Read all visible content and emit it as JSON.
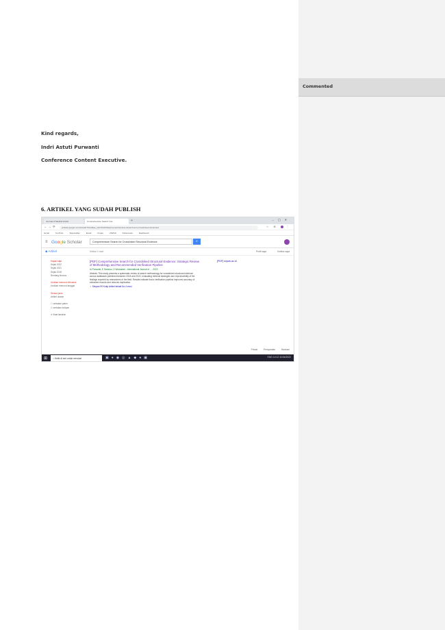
{
  "letter": {
    "closing": "Kind regards,",
    "name": "Indri Astuti Purwanti",
    "role": "Conference Content Executive."
  },
  "section_heading": "6.   ARTIKEL YANG SUDAH PUBLISH",
  "comments": {
    "header": "Commented"
  },
  "screenshot": {
    "tabs": [
      "Journal of Medical Article",
      "Comprehensive Search Cas"
    ],
    "url": "scholar.google.com/scholar?hl=id&as_sdt=0%2C5&q=Comprehensive+Search+for+Crosslinked+Structural",
    "bookmarks": [
      "Gmail",
      "YouTube",
      "Terjemahan",
      "Email",
      "Unpas",
      "UNPAS",
      "Kubernetes",
      "Dashboard"
    ],
    "logo": {
      "g1": "Go",
      "g2": "o",
      "g3": "g",
      "g4": "le",
      "scholar": "Scholar"
    },
    "search_query": "Comprehensive Search for Crosslinked Structural Evidence",
    "articles_label": "Artikel",
    "result_count": "Sekitar 1 hasil",
    "my_profile": "Profil saya",
    "my_library": "Koleksi saya",
    "sidebar": [
      "Kapan saja",
      "Sejak 2022",
      "Sejak 2021",
      "Sejak 2018",
      "Rentang khusus...",
      "",
      "Urutkan menurut relevansi",
      "Urutkan menurut tanggal",
      "",
      "Semua jenis",
      "Artikel ulasan",
      "",
      "sertakan paten",
      "sertakan kutipan",
      "",
      "Buat lansiran"
    ],
    "result": {
      "title": "[PDF] Comprehensive Search for Crosslinked Structural Evidence: Strategic Review of Methodology and Recommended Verification Pipeline",
      "authors": "IA Purwanti, E Santoso, D Wulandari - International Journal of ..., 2022",
      "snippet": "Abstrak: This study presents a systematic review of search methodology for crosslinked structural evidence across databases published between 2018 and 2022, evaluating retrieval strategies and reproducibility of the findings reported by researchers in the field. Results indicate that a verification pipeline improves accuracy of extracted records and reduces duplication.",
      "links": "☆ Simpan   99 Kutip   Artikel terkait   Ke-4 versi"
    },
    "pdf_link": "[PDF] unpas.ac.id",
    "footer": [
      "Privasi",
      "Persyaratan",
      "Bantuan"
    ],
    "taskbar_search": "Ketik di sini untuk mencari",
    "tray": "ENG  14:12  11/04/2022"
  }
}
